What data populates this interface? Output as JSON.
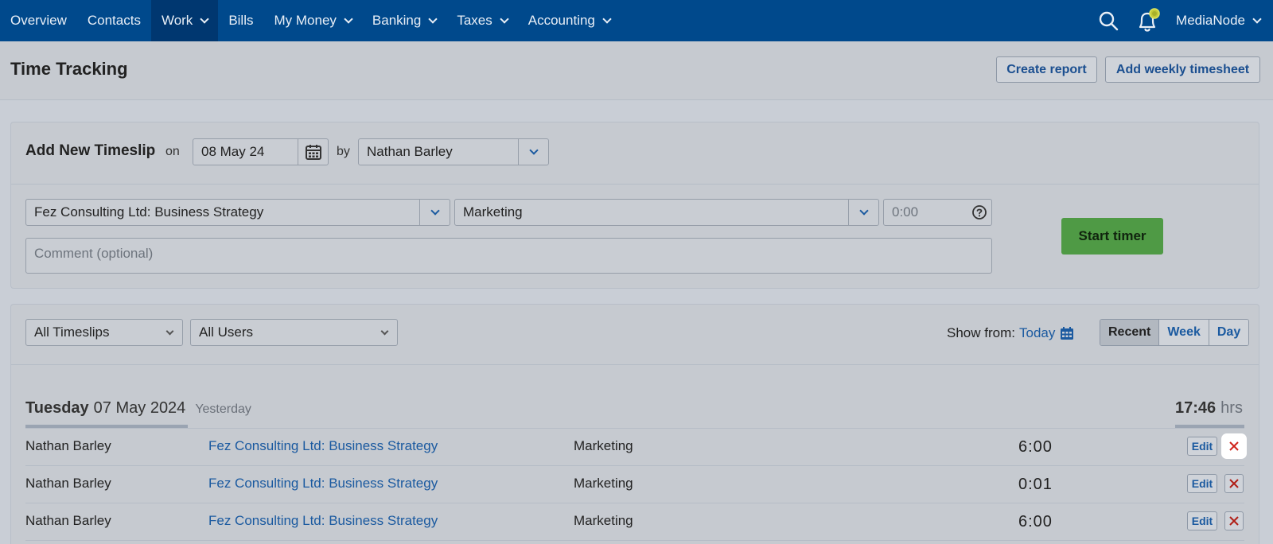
{
  "nav": {
    "items": [
      {
        "label": "Overview",
        "dropdown": false,
        "active": false
      },
      {
        "label": "Contacts",
        "dropdown": false,
        "active": false
      },
      {
        "label": "Work",
        "dropdown": true,
        "active": true
      },
      {
        "label": "Bills",
        "dropdown": false,
        "active": false
      },
      {
        "label": "My Money",
        "dropdown": true,
        "active": false
      },
      {
        "label": "Banking",
        "dropdown": true,
        "active": false
      },
      {
        "label": "Taxes",
        "dropdown": true,
        "active": false
      },
      {
        "label": "Accounting",
        "dropdown": true,
        "active": false
      }
    ],
    "user": "MediaNode",
    "icons": [
      "search-icon",
      "bell-icon"
    ],
    "color": "#00498c"
  },
  "header": {
    "title": "Time Tracking",
    "create_report": "Create report",
    "add_weekly": "Add weekly timesheet"
  },
  "timeslip": {
    "title": "Add New Timeslip",
    "on_label": "on",
    "date": "08 May 24",
    "by_label": "by",
    "user": "Nathan Barley",
    "project": "Fez Consulting Ltd: Business Strategy",
    "task": "Marketing",
    "hours_placeholder": "0:00",
    "comment_placeholder": "Comment (optional)",
    "start_timer": "Start timer",
    "start_color": "#4f9a45"
  },
  "filters": {
    "timeslips": "All Timeslips",
    "users": "All Users",
    "show_from_label": "Show from:",
    "show_from_value": "Today",
    "views": [
      "Recent",
      "Week",
      "Day"
    ],
    "active_view": "Recent"
  },
  "day": {
    "weekday": "Tuesday",
    "date": "07 May 2024",
    "relative": "Yesterday",
    "total": "17:46",
    "unit": "hrs"
  },
  "entries": [
    {
      "user": "Nathan Barley",
      "project": "Fez Consulting Ltd: Business Strategy",
      "task": "Marketing",
      "hours": "6:00",
      "edit": "Edit"
    },
    {
      "user": "Nathan Barley",
      "project": "Fez Consulting Ltd: Business Strategy",
      "task": "Marketing",
      "hours": "0:01",
      "edit": "Edit"
    },
    {
      "user": "Nathan Barley",
      "project": "Fez Consulting Ltd: Business Strategy",
      "task": "Marketing",
      "hours": "6:00",
      "edit": "Edit"
    }
  ]
}
